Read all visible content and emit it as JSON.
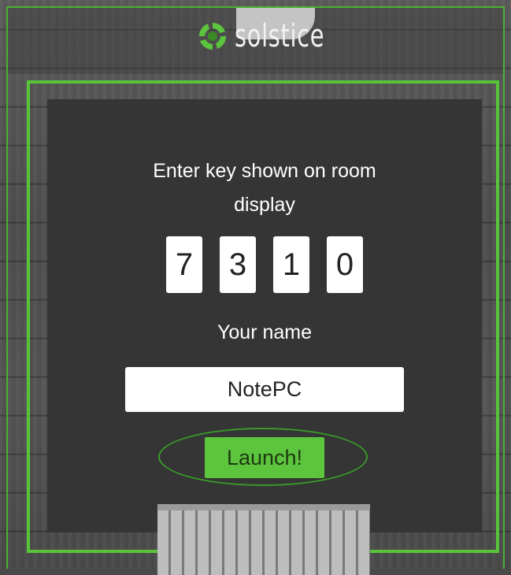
{
  "brand": {
    "name": "solstice",
    "logo_icon": "solstice-swirl-icon",
    "accent_color": "#58c43a"
  },
  "connect_form": {
    "prompt_line1": "Enter key shown on room",
    "prompt_line2": "display",
    "key_digits": [
      "7",
      "3",
      "1",
      "0"
    ],
    "name_label": "Your name",
    "name_value": "NotePC",
    "launch_label": "Launch!"
  },
  "colors": {
    "panel": "#353535",
    "button": "#5cc43d",
    "frame": "#58c43a"
  }
}
